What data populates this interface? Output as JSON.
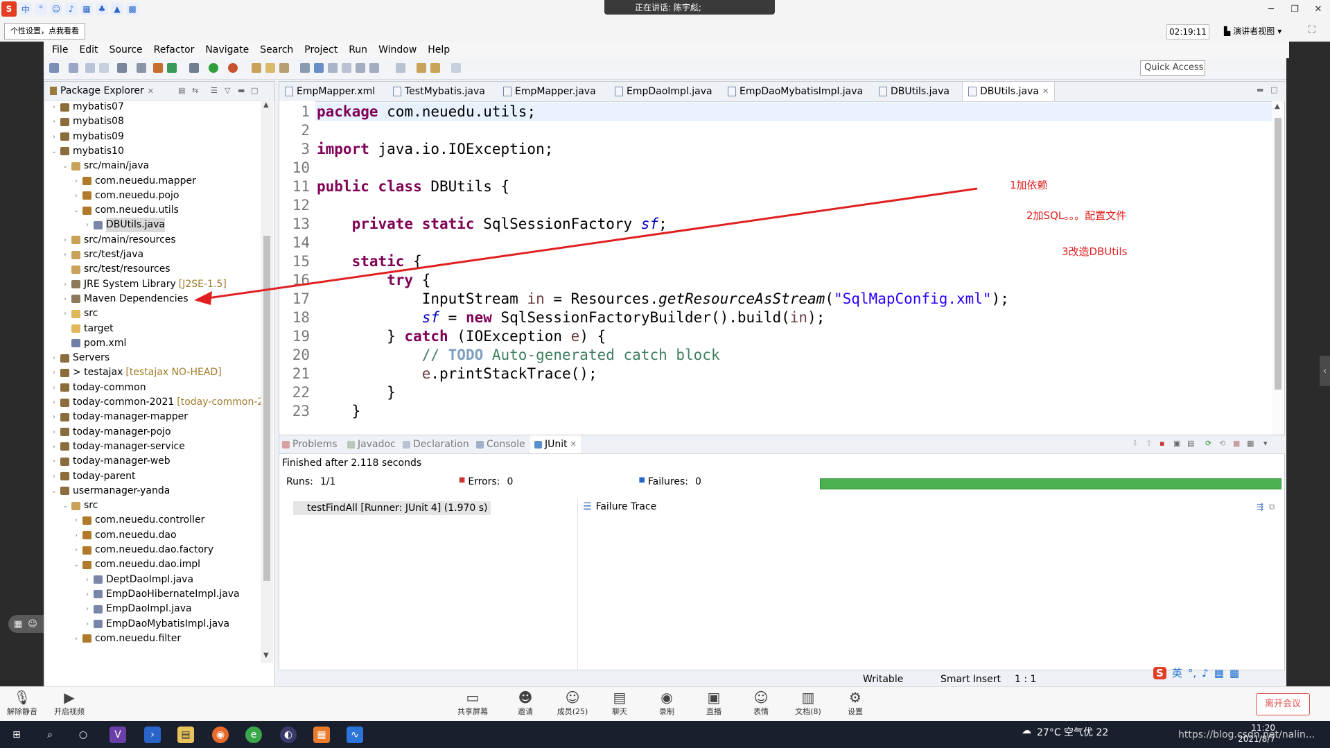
{
  "desktop": {
    "speaking": "正在讲话: 陈宇彪;",
    "personal_settings": "个性设置，点我看看",
    "timer": "02:19:11",
    "presenter_view": "演讲者视图",
    "ime_mode": "中"
  },
  "menu": [
    "File",
    "Edit",
    "Source",
    "Refactor",
    "Navigate",
    "Search",
    "Project",
    "Run",
    "Window",
    "Help"
  ],
  "quick_access": "Quick Access",
  "package_explorer": {
    "title": "Package Explorer",
    "rows": [
      {
        "label": "mybatis07",
        "indent": 0,
        "tw": "›",
        "icon": "#8a6d3b"
      },
      {
        "label": "mybatis08",
        "indent": 0,
        "tw": "›",
        "icon": "#8a6d3b"
      },
      {
        "label": "mybatis09",
        "indent": 0,
        "tw": "›",
        "icon": "#8a6d3b"
      },
      {
        "label": "mybatis10",
        "indent": 0,
        "tw": "⌄",
        "icon": "#8a6d3b"
      },
      {
        "label": "src/main/java",
        "indent": 1,
        "tw": "⌄",
        "icon": "#c9a25a"
      },
      {
        "label": "com.neuedu.mapper",
        "indent": 2,
        "tw": "›",
        "icon": "#b07a2b"
      },
      {
        "label": "com.neuedu.pojo",
        "indent": 2,
        "tw": "›",
        "icon": "#b07a2b"
      },
      {
        "label": "com.neuedu.utils",
        "indent": 2,
        "tw": "⌄",
        "icon": "#b07a2b"
      },
      {
        "label": "DBUtils.java",
        "indent": 3,
        "tw": "›",
        "icon": "#7a86a8",
        "sel": true
      },
      {
        "label": "src/main/resources",
        "indent": 1,
        "tw": "›",
        "icon": "#c9a25a"
      },
      {
        "label": "src/test/java",
        "indent": 1,
        "tw": "›",
        "icon": "#c9a25a"
      },
      {
        "label": "src/test/resources",
        "indent": 1,
        "tw": "",
        "icon": "#c9a25a"
      },
      {
        "label": "JRE System Library",
        "indent": 1,
        "tw": "›",
        "icon": "#8c7a5a",
        "dec": "[J2SE-1.5]"
      },
      {
        "label": "Maven Dependencies",
        "indent": 1,
        "tw": "›",
        "icon": "#8c7a5a"
      },
      {
        "label": "src",
        "indent": 1,
        "tw": "›",
        "icon": "#e0b75a"
      },
      {
        "label": "target",
        "indent": 1,
        "tw": "",
        "icon": "#e0b75a"
      },
      {
        "label": "pom.xml",
        "indent": 1,
        "tw": "",
        "icon": "#6f7fa8"
      },
      {
        "label": "Servers",
        "indent": 0,
        "tw": "›",
        "icon": "#8a6d3b"
      },
      {
        "label": "> testajax",
        "indent": 0,
        "tw": "›",
        "icon": "#8a6d3b",
        "dec": "[testajax NO-HEAD]"
      },
      {
        "label": "today-common",
        "indent": 0,
        "tw": "›",
        "icon": "#8a6d3b"
      },
      {
        "label": "today-common-2021",
        "indent": 0,
        "tw": "›",
        "icon": "#8a6d3b",
        "dec": "[today-common-2"
      },
      {
        "label": "today-manager-mapper",
        "indent": 0,
        "tw": "›",
        "icon": "#8a6d3b"
      },
      {
        "label": "today-manager-pojo",
        "indent": 0,
        "tw": "›",
        "icon": "#8a6d3b"
      },
      {
        "label": "today-manager-service",
        "indent": 0,
        "tw": "›",
        "icon": "#8a6d3b"
      },
      {
        "label": "today-manager-web",
        "indent": 0,
        "tw": "›",
        "icon": "#8a6d3b"
      },
      {
        "label": "today-parent",
        "indent": 0,
        "tw": "›",
        "icon": "#8a6d3b"
      },
      {
        "label": "usermanager-yanda",
        "indent": 0,
        "tw": "⌄",
        "icon": "#8a6d3b"
      },
      {
        "label": "src",
        "indent": 1,
        "tw": "⌄",
        "icon": "#c9a25a"
      },
      {
        "label": "com.neuedu.controller",
        "indent": 2,
        "tw": "›",
        "icon": "#b07a2b"
      },
      {
        "label": "com.neuedu.dao",
        "indent": 2,
        "tw": "›",
        "icon": "#b07a2b"
      },
      {
        "label": "com.neuedu.dao.factory",
        "indent": 2,
        "tw": "›",
        "icon": "#b07a2b"
      },
      {
        "label": "com.neuedu.dao.impl",
        "indent": 2,
        "tw": "⌄",
        "icon": "#b07a2b"
      },
      {
        "label": "DeptDaoImpl.java",
        "indent": 3,
        "tw": "›",
        "icon": "#7a86a8"
      },
      {
        "label": "EmpDaoHibernateImpl.java",
        "indent": 3,
        "tw": "›",
        "icon": "#7a86a8"
      },
      {
        "label": "EmpDaoImpl.java",
        "indent": 3,
        "tw": "›",
        "icon": "#7a86a8"
      },
      {
        "label": "EmpDaoMybatisImpl.java",
        "indent": 3,
        "tw": "›",
        "icon": "#7a86a8"
      },
      {
        "label": "com.neuedu.filter",
        "indent": 2,
        "tw": "›",
        "icon": "#b07a2b"
      }
    ]
  },
  "editor": {
    "tabs": [
      "EmpMapper.xml",
      "TestMybatis.java",
      "EmpMapper.java",
      "EmpDaoImpl.java",
      "EmpDaoMybatisImpl.java",
      "DBUtils.java",
      "DBUtils.java"
    ],
    "line_numbers": [
      "1",
      "2",
      "3",
      "10",
      "11",
      "12",
      "13",
      "14",
      "15",
      "16",
      "17",
      "18",
      "19",
      "20",
      "21",
      "22",
      "23"
    ],
    "code": {
      "l1a": "package",
      "l1b": " com.neuedu.utils;",
      "l3a": "import",
      "l3b": " java.io.IOException;",
      "l11a": "public class",
      "l11b": " DBUtils {",
      "l13a": "    private static",
      "l13b": " SqlSessionFactory ",
      "l13c": "sf",
      "l13d": ";",
      "l15a": "    static",
      "l15b": " {",
      "l16a": "        try",
      "l16b": " {",
      "l17a": "            InputStream ",
      "l17b": "in",
      "l17c": " = Resources.",
      "l17d": "getResourceAsStream",
      "l17e": "(",
      "l17f": "\"SqlMapConfig.xml\"",
      "l17g": ");",
      "l18a": "            ",
      "l18b": "sf",
      "l18c": " = ",
      "l18d": "new",
      "l18e": " SqlSessionFactoryBuilder().build(",
      "l18f": "in",
      "l18g": ");",
      "l19a": "        } ",
      "l19b": "catch",
      "l19c": " (IOException ",
      "l19d": "e",
      "l19e": ") {",
      "l20a": "            // ",
      "l20b": "TODO",
      "l20c": " Auto-generated catch block",
      "l21a": "            ",
      "l21b": "e",
      "l21c": ".printStackTrace();",
      "l22": "        }",
      "l23": "    }"
    }
  },
  "annotations": {
    "note1": "1加依赖",
    "note2": "2加SQL。。。配置文件",
    "note3": "3改造DBUtils",
    "arrow_color": "#e02020"
  },
  "bottom": {
    "tabs": [
      "Problems",
      "Javadoc",
      "Declaration",
      "Console",
      "JUnit"
    ],
    "finished": "Finished after 2.118 seconds",
    "runs_label": "Runs:",
    "runs_value": "1/1",
    "errors_label": "Errors:",
    "errors_value": "0",
    "failures_label": "Failures:",
    "failures_value": "0",
    "test_item": "testFindAll [Runner: JUnit 4] (1.970 s)",
    "failure_trace": "Failure Trace",
    "progress_color": "#4caf50"
  },
  "status": {
    "writable": "Writable",
    "insert": "Smart Insert",
    "position": "1 : 1"
  },
  "meeting": {
    "mute": "解除静音",
    "video": "开启视频",
    "share": "共享屏幕",
    "invite": "邀请",
    "members": "成员(25)",
    "chat": "聊天",
    "record": "录制",
    "live": "直播",
    "emoji": "表情",
    "docs": "文档(8)",
    "settings": "设置",
    "leave": "离开会议"
  },
  "taskbar": {
    "weather": "27°C  空气优 22",
    "watermark": "https://blog.csdn.net/nalin...",
    "time": "11:20",
    "date": "2021/8/7",
    "ime_bottom": "英"
  }
}
